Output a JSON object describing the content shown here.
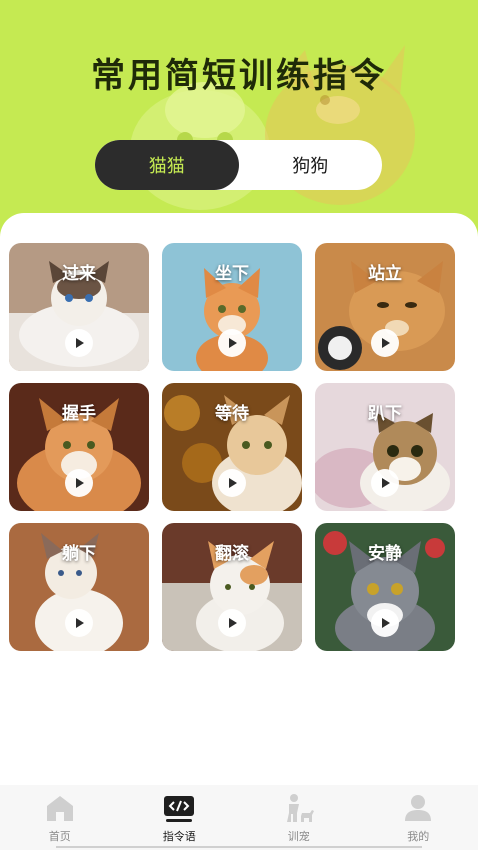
{
  "header": {
    "title": "常用简短训练指令"
  },
  "segment": {
    "tabs": [
      {
        "label": "猫猫",
        "active": true
      },
      {
        "label": "狗狗",
        "active": false
      }
    ]
  },
  "commands": [
    {
      "label": "过来",
      "icon": "play-icon"
    },
    {
      "label": "坐下",
      "icon": "play-icon"
    },
    {
      "label": "站立",
      "icon": "play-icon"
    },
    {
      "label": "握手",
      "icon": "play-icon"
    },
    {
      "label": "等待",
      "icon": "play-icon"
    },
    {
      "label": "趴下",
      "icon": "play-icon"
    },
    {
      "label": "躺下",
      "icon": "play-icon"
    },
    {
      "label": "翻滚",
      "icon": "play-icon"
    },
    {
      "label": "安静",
      "icon": "play-icon"
    }
  ],
  "tabbar": {
    "items": [
      {
        "label": "首页",
        "icon": "home-icon"
      },
      {
        "label": "指令语",
        "icon": "code-icon",
        "active": true
      },
      {
        "label": "训宠",
        "icon": "person-dog-icon"
      },
      {
        "label": "我的",
        "icon": "user-icon"
      }
    ]
  },
  "colors": {
    "accent": "#c5ea52",
    "dark": "#2c2c2c"
  }
}
